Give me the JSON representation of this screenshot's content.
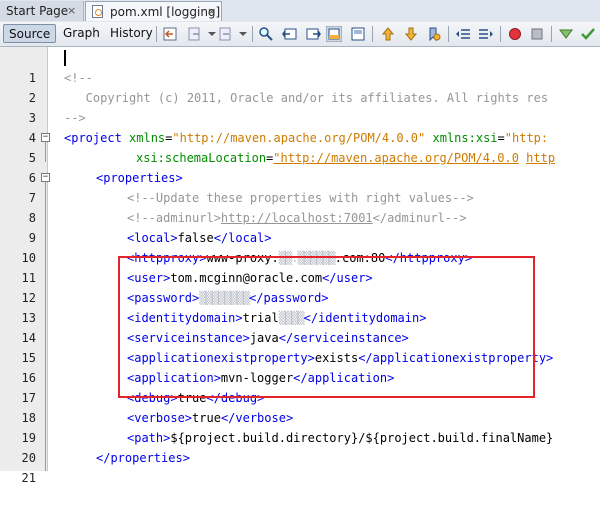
{
  "tabs": [
    {
      "label": "Start Page",
      "close": "×"
    },
    {
      "label": "pom.xml [logging]",
      "close": "×"
    }
  ],
  "toolbar": {
    "views": [
      "Source",
      "Graph",
      "History"
    ],
    "active_view": "Source"
  },
  "editor": {
    "lines": [
      {
        "n": "1",
        "fold": ""
      },
      {
        "n": "2",
        "fold": ""
      },
      {
        "n": "3",
        "fold": ""
      },
      {
        "n": "4",
        "fold": ""
      },
      {
        "n": "5",
        "fold": "−"
      },
      {
        "n": "6",
        "fold": ""
      },
      {
        "n": "7",
        "fold": "−"
      },
      {
        "n": "8",
        "fold": ""
      },
      {
        "n": "9",
        "fold": ""
      },
      {
        "n": "10",
        "fold": ""
      },
      {
        "n": "11",
        "fold": ""
      },
      {
        "n": "12",
        "fold": ""
      },
      {
        "n": "13",
        "fold": ""
      },
      {
        "n": "14",
        "fold": ""
      },
      {
        "n": "15",
        "fold": ""
      },
      {
        "n": "16",
        "fold": ""
      },
      {
        "n": "17",
        "fold": ""
      },
      {
        "n": "18",
        "fold": ""
      },
      {
        "n": "19",
        "fold": ""
      },
      {
        "n": "20",
        "fold": ""
      },
      {
        "n": "21",
        "fold": ""
      }
    ],
    "code": {
      "l2": "<!--",
      "l3": "   Copyright (c) 2011, Oracle and/or its affiliates. All rights res",
      "l4": "-->",
      "l5_open": "<project",
      "l5_a1": "xmlns",
      "l5_v1": "\"http://maven.apache.org/POM/4.0.0\"",
      "l5_a2": "xmlns:xsi",
      "l5_v2": "\"http:",
      "l6_a": "xsi:schemaLocation",
      "l6_v1": "\"http://maven.apache.org/POM/4.0.0",
      "l6_v2": "http",
      "l7": "<properties>",
      "l8": "<!--Update these properties with right values-->",
      "l9_pre": "<!--adminurl>",
      "l9_url": "http://localhost:7001",
      "l9_post": "</adminurl-->",
      "l10_o": "<local>",
      "l10_t": "false",
      "l10_c": "</local>",
      "l11_o": "<httpproxy>",
      "l11_t1": "www-proxy.",
      "l11_blur": "▒▒.▒▒▒▒▒▒",
      "l11_t2": ".com:80",
      "l11_c": "</httpproxy>",
      "l12_o": "<user>",
      "l12_t": "tom.mcginn@oracle.com",
      "l12_c": "</user>",
      "l13_o": "<password>",
      "l13_blur": "▒▒▒▒▒▒▒▒",
      "l13_c": "</password>",
      "l14_o": "<identitydomain>",
      "l14_t": "trial",
      "l14_blur": "▒▒▒▒",
      "l14_c": "</identitydomain>",
      "l15_o": "<serviceinstance>",
      "l15_t": "java",
      "l15_c": "</serviceinstance>",
      "l16_o": "<applicationexistproperty>",
      "l16_t": "exists",
      "l16_c": "</applicationexistproperty>",
      "l17_o": "<application>",
      "l17_t": "mvn-logger",
      "l17_c": "</application>",
      "l18_o": "<debug>",
      "l18_t": "true",
      "l18_c": "</debug>",
      "l19_o": "<verbose>",
      "l19_t": "true",
      "l19_c": "</verbose>",
      "l20_o": "<path>",
      "l20_t": "${project.build.directory}/${project.build.finalName}",
      "l21": "</properties>"
    }
  }
}
